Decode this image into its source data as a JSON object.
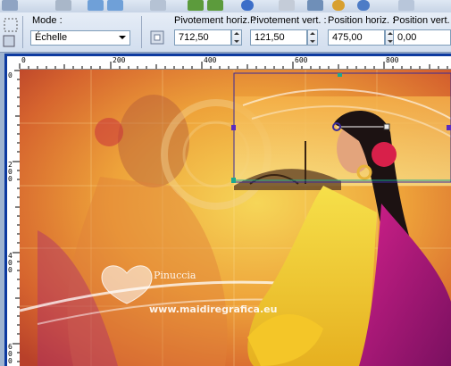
{
  "toolbar": {
    "icons": [
      "layers-icon",
      "print-icon",
      "undo-icon",
      "redo-icon",
      "copy-icon",
      "rotate-left-icon",
      "rotate-right-icon",
      "info-icon",
      "grid-icon",
      "zoom-icon",
      "zoom-fit-icon",
      "document-icon"
    ]
  },
  "properties": {
    "mode_label": "Mode :",
    "mode_value": "Échelle",
    "rot_h_label": "Pivotement horiz. :",
    "rot_h_value": "712,50",
    "rot_v_label": "Pivotement vert. :",
    "rot_v_value": "121,50",
    "pos_h_label": "Position horiz. :",
    "pos_h_value": "475,00",
    "pos_v_label": "Position vert. :",
    "pos_v_value": "0,00"
  },
  "ruler": {
    "h_labels": [
      "0",
      "200",
      "400",
      "600",
      "800"
    ],
    "v_labels": [
      "0",
      "2\n0\n0",
      "4\n0\n0",
      "6\n0\n0"
    ]
  },
  "watermark": {
    "name": "Pinuccia",
    "url": "www.maidiregrafica.eu"
  },
  "colors": {
    "canvas_border": "#0d3aa0",
    "selection": "#5a2cc0",
    "handle": "#1aa890"
  }
}
